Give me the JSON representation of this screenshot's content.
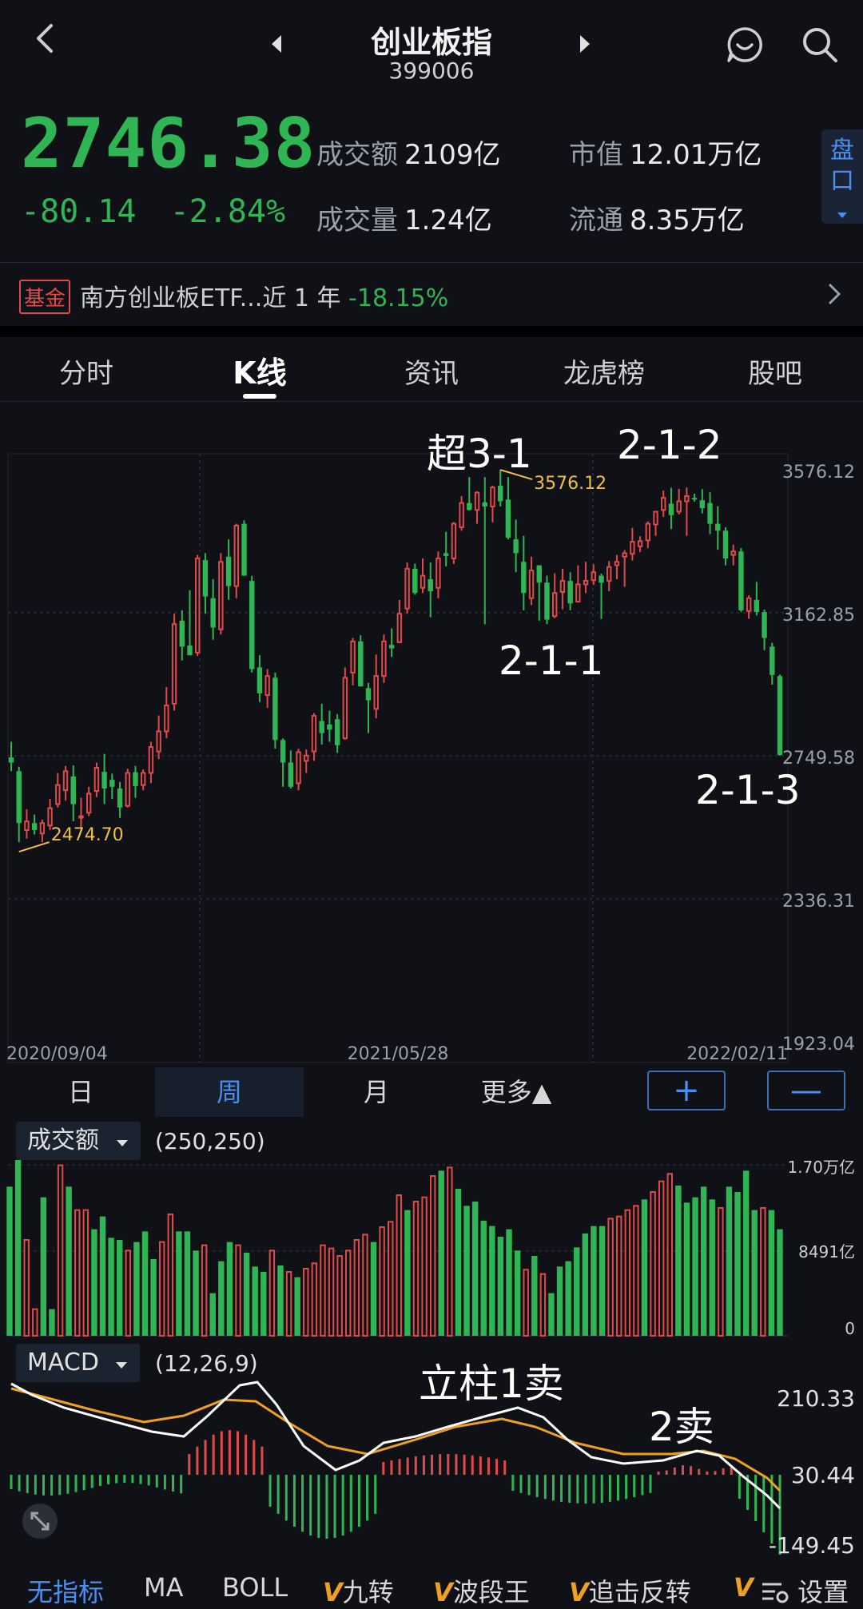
{
  "header": {
    "title": "创业板指",
    "code": "399006"
  },
  "quote": {
    "price": "2746.38",
    "change": "-80.14",
    "change_pct": "-2.84%",
    "turnover_label": "成交额",
    "turnover_value": "2109亿",
    "volume_label": "成交量",
    "volume_value": "1.24亿",
    "mktcap_label": "市值",
    "mktcap_value": "12.01万亿",
    "float_label": "流通",
    "float_value": "8.35万亿",
    "pankou_label": "盘口"
  },
  "fund": {
    "badge": "基金",
    "text": "南方创业板ETF...近 1 年 ",
    "return": "-18.15%"
  },
  "tabs": [
    "分时",
    "K线",
    "资讯",
    "龙虎榜",
    "股吧"
  ],
  "periods": [
    "日",
    "周",
    "月",
    "更多▲"
  ],
  "zoom": {
    "plus": "+",
    "minus": "—"
  },
  "volume_panel": {
    "indicator": "成交额",
    "params": "(250,250)",
    "axis_labels": [
      "1.70万亿",
      "8491亿",
      "0"
    ]
  },
  "macd_panel": {
    "indicator": "MACD",
    "params": "(12,26,9)",
    "axis_labels": [
      "210.33",
      "30.44",
      "-149.45"
    ]
  },
  "indicators": [
    "无指标",
    "MA",
    "BOLL",
    "九转",
    "波段王",
    "追击反转",
    "设置"
  ],
  "annotations": [
    "超3-1",
    "2-1-2",
    "2-1-1",
    "2-1-3",
    "立柱1卖",
    "2卖"
  ],
  "colors": {
    "up": "#e24a4a",
    "down": "#2fb554",
    "accent": "#4a8ef0",
    "dif": "#ffffff",
    "dea": "#f0a020"
  },
  "chart_data": {
    "type": "candlestick",
    "period": "week",
    "x_labels": [
      "2020/09/04",
      "2021/05/28",
      "2022/02/11"
    ],
    "y_ticks": [
      3576.12,
      3162.85,
      2749.58,
      2336.31,
      1923.04
    ],
    "ylim": [
      1923.04,
      3576.12
    ],
    "high_label": "3576.12",
    "low_label": "2474.70",
    "candles": [
      [
        2745,
        2730,
        2790,
        2705
      ],
      [
        2705,
        2555,
        2718,
        2500
      ],
      [
        2535,
        2560,
        2595,
        2510
      ],
      [
        2555,
        2535,
        2580,
        2522
      ],
      [
        2525,
        2555,
        2565,
        2500
      ],
      [
        2548,
        2598,
        2625,
        2535
      ],
      [
        2610,
        2665,
        2700,
        2600
      ],
      [
        2650,
        2705,
        2720,
        2620
      ],
      [
        2690,
        2610,
        2722,
        2560
      ],
      [
        2572,
        2575,
        2628,
        2540
      ],
      [
        2585,
        2640,
        2660,
        2575
      ],
      [
        2648,
        2715,
        2730,
        2630
      ],
      [
        2703,
        2655,
        2755,
        2610
      ],
      [
        2680,
        2660,
        2698,
        2625
      ],
      [
        2655,
        2600,
        2674,
        2570
      ],
      [
        2605,
        2700,
        2712,
        2600
      ],
      [
        2702,
        2662,
        2720,
        2628
      ],
      [
        2665,
        2700,
        2710,
        2650
      ],
      [
        2700,
        2775,
        2790,
        2670
      ],
      [
        2762,
        2820,
        2866,
        2740
      ],
      [
        2820,
        2895,
        2948,
        2800
      ],
      [
        2900,
        3130,
        3160,
        2880
      ],
      [
        3140,
        3065,
        3170,
        3025
      ],
      [
        3068,
        3040,
        3228,
        3040
      ],
      [
        3048,
        3320,
        3330,
        3038
      ],
      [
        3315,
        3210,
        3335,
        3160
      ],
      [
        3205,
        3120,
        3260,
        3085
      ],
      [
        3115,
        3310,
        3335,
        3100
      ],
      [
        3325,
        3240,
        3375,
        3200
      ],
      [
        3240,
        3415,
        3420,
        3205
      ],
      [
        3420,
        3270,
        3430,
        3270
      ],
      [
        3255,
        3000,
        3270,
        2990
      ],
      [
        3005,
        2930,
        3040,
        2905
      ],
      [
        2925,
        2980,
        3000,
        2888
      ],
      [
        2975,
        2795,
        2990,
        2770
      ],
      [
        2795,
        2730,
        2800,
        2660
      ],
      [
        2730,
        2660,
        2765,
        2655
      ],
      [
        2670,
        2760,
        2770,
        2650
      ],
      [
        2735,
        2750,
        2768,
        2700
      ],
      [
        2762,
        2865,
        2873,
        2735
      ],
      [
        2850,
        2815,
        2900,
        2782
      ],
      [
        2840,
        2825,
        2880,
        2790
      ],
      [
        2855,
        2780,
        2870,
        2758
      ],
      [
        2800,
        2975,
        3005,
        2796
      ],
      [
        2990,
        3080,
        3090,
        2953
      ],
      [
        3080,
        2950,
        3098,
        2950
      ],
      [
        2945,
        2910,
        2960,
        2815
      ],
      [
        2885,
        2980,
        3042,
        2858
      ],
      [
        2980,
        3080,
        3100,
        2960
      ],
      [
        3070,
        3060,
        3118,
        3035
      ],
      [
        3078,
        3160,
        3200,
        3075
      ],
      [
        3175,
        3290,
        3308,
        3160
      ],
      [
        3290,
        3220,
        3305,
        3215
      ],
      [
        3235,
        3270,
        3320,
        3220
      ],
      [
        3260,
        3225,
        3308,
        3150
      ],
      [
        3235,
        3320,
        3340,
        3205
      ],
      [
        3335,
        3327,
        3397,
        3297
      ],
      [
        3320,
        3420,
        3425,
        3304
      ],
      [
        3410,
        3480,
        3500,
        3400
      ],
      [
        3480,
        3460,
        3555,
        3458
      ],
      [
        3460,
        3510,
        3514,
        3420
      ],
      [
        3482,
        3470,
        3555,
        3130
      ],
      [
        3470,
        3525,
        3530,
        3424
      ],
      [
        3530,
        3485,
        3576,
        3470
      ],
      [
        3490,
        3380,
        3555,
        3375
      ],
      [
        3375,
        3335,
        3432,
        3280
      ],
      [
        3310,
        3220,
        3385,
        3170
      ],
      [
        3205,
        3285,
        3325,
        3185
      ],
      [
        3300,
        3250,
        3300,
        3140
      ],
      [
        3250,
        3143,
        3270,
        3130
      ],
      [
        3153,
        3220,
        3277,
        3147
      ],
      [
        3223,
        3255,
        3290,
        3173
      ],
      [
        3255,
        3190,
        3280,
        3170
      ],
      [
        3195,
        3245,
        3300,
        3192
      ],
      [
        3245,
        3255,
        3310,
        3220
      ],
      [
        3257,
        3280,
        3303,
        3243
      ],
      [
        3270,
        3250,
        3276,
        3145
      ],
      [
        3255,
        3295,
        3312,
        3225
      ],
      [
        3300,
        3310,
        3330,
        3260
      ],
      [
        3325,
        3335,
        3344,
        3238
      ],
      [
        3333,
        3368,
        3408,
        3314
      ],
      [
        3355,
        3370,
        3384,
        3338
      ],
      [
        3372,
        3420,
        3427,
        3350
      ],
      [
        3418,
        3455,
        3456,
        3385
      ],
      [
        3460,
        3495,
        3516,
        3440
      ],
      [
        3478,
        3445,
        3524,
        3405
      ],
      [
        3455,
        3485,
        3521,
        3447
      ],
      [
        3485,
        3500,
        3525,
        3385
      ],
      [
        3495,
        3490,
        3507,
        3484
      ],
      [
        3488,
        3465,
        3520,
        3450
      ],
      [
        3480,
        3420,
        3511,
        3390
      ],
      [
        3420,
        3400,
        3471,
        3345
      ],
      [
        3400,
        3320,
        3410,
        3300
      ],
      [
        3330,
        3340,
        3360,
        3300
      ],
      [
        3340,
        3170,
        3350,
        3165
      ],
      [
        3168,
        3205,
        3213,
        3145
      ],
      [
        3200,
        3165,
        3252,
        3155
      ],
      [
        3165,
        3090,
        3172,
        3055
      ],
      [
        3065,
        2983,
        3076,
        2955
      ],
      [
        2980,
        2752,
        2984,
        2750
      ]
    ],
    "volume": [
      [
        140,
        "down"
      ],
      [
        165,
        "down"
      ],
      [
        90,
        "up"
      ],
      [
        25,
        "up"
      ],
      [
        130,
        "down"
      ],
      [
        25,
        "down"
      ],
      [
        160,
        "up"
      ],
      [
        140,
        "down"
      ],
      [
        118,
        "up"
      ],
      [
        118,
        "up"
      ],
      [
        100,
        "down"
      ],
      [
        112,
        "down"
      ],
      [
        92,
        "down"
      ],
      [
        90,
        "down"
      ],
      [
        80,
        "up"
      ],
      [
        88,
        "down"
      ],
      [
        98,
        "down"
      ],
      [
        72,
        "down"
      ],
      [
        88,
        "up"
      ],
      [
        114,
        "up"
      ],
      [
        98,
        "down"
      ],
      [
        98,
        "down"
      ],
      [
        80,
        "down"
      ],
      [
        85,
        "up"
      ],
      [
        40,
        "down"
      ],
      [
        70,
        "down"
      ],
      [
        88,
        "down"
      ],
      [
        85,
        "up"
      ],
      [
        78,
        "down"
      ],
      [
        65,
        "down"
      ],
      [
        60,
        "down"
      ],
      [
        80,
        "up"
      ],
      [
        66,
        "down"
      ],
      [
        60,
        "up"
      ],
      [
        55,
        "down"
      ],
      [
        63,
        "up"
      ],
      [
        68,
        "up"
      ],
      [
        85,
        "up"
      ],
      [
        82,
        "up"
      ],
      [
        75,
        "up"
      ],
      [
        80,
        "up"
      ],
      [
        90,
        "up"
      ],
      [
        95,
        "up"
      ],
      [
        88,
        "down"
      ],
      [
        102,
        "up"
      ],
      [
        107,
        "up"
      ],
      [
        132,
        "up"
      ],
      [
        118,
        "down"
      ],
      [
        126,
        "up"
      ],
      [
        130,
        "up"
      ],
      [
        150,
        "up"
      ],
      [
        155,
        "down"
      ],
      [
        158,
        "up"
      ],
      [
        138,
        "down"
      ],
      [
        122,
        "down"
      ],
      [
        126,
        "down"
      ],
      [
        108,
        "down"
      ],
      [
        103,
        "down"
      ],
      [
        93,
        "down"
      ],
      [
        100,
        "down"
      ],
      [
        80,
        "down"
      ],
      [
        62,
        "up"
      ],
      [
        75,
        "down"
      ],
      [
        58,
        "up"
      ],
      [
        40,
        "down"
      ],
      [
        65,
        "down"
      ],
      [
        70,
        "down"
      ],
      [
        83,
        "down"
      ],
      [
        96,
        "down"
      ],
      [
        103,
        "down"
      ],
      [
        103,
        "down"
      ],
      [
        110,
        "up"
      ],
      [
        112,
        "up"
      ],
      [
        118,
        "up"
      ],
      [
        122,
        "up"
      ],
      [
        128,
        "down"
      ],
      [
        135,
        "up"
      ],
      [
        145,
        "up"
      ],
      [
        152,
        "up"
      ],
      [
        141,
        "down"
      ],
      [
        125,
        "down"
      ],
      [
        130,
        "down"
      ],
      [
        140,
        "down"
      ],
      [
        128,
        "down"
      ],
      [
        120,
        "up"
      ],
      [
        140,
        "down"
      ],
      [
        135,
        "down"
      ],
      [
        155,
        "down"
      ],
      [
        118,
        "down"
      ],
      [
        120,
        "up"
      ],
      [
        118,
        "down"
      ],
      [
        100,
        "down"
      ]
    ],
    "macd_axis": [
      210.33,
      30.44,
      -149.45
    ]
  }
}
